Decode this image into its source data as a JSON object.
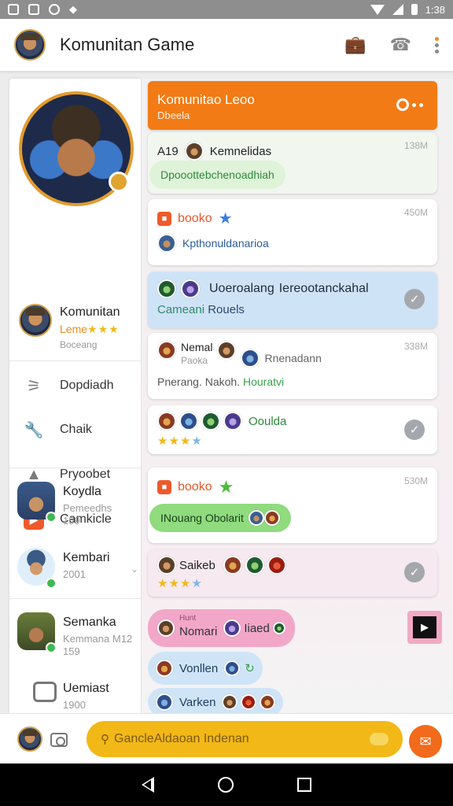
{
  "status_bar": {
    "time": "1:38"
  },
  "app_bar": {
    "title": "Komunitan Game"
  },
  "sidebar": {
    "me": {
      "name": "Komunitan",
      "level": "Leme",
      "stars": "★★★",
      "sub": "Boceang"
    },
    "menu": [
      {
        "label": "Dopdiadh",
        "icon": "puzzle-icon"
      },
      {
        "label": "Chaik",
        "icon": "wrench-icon"
      },
      {
        "label": "Pryoobet",
        "icon": "bag-icon"
      },
      {
        "label": "Camkicle",
        "icon": "games-icon"
      }
    ],
    "contacts": [
      {
        "name": "Koydla",
        "sub1": "Pemeedhs",
        "sub2": "159"
      },
      {
        "name": "Kembari",
        "sub1": "2001"
      },
      {
        "name": "Semanka",
        "sub1": "Kemmana M12",
        "sub2": "159"
      },
      {
        "name": "Uemiast",
        "sub1": "1900"
      }
    ]
  },
  "chat": {
    "header": {
      "title": "Komunitao Leoo",
      "sub": "Dbeela"
    },
    "messages": [
      {
        "sender": "A19",
        "name": "Kemnelidas",
        "time": "138M",
        "bubble": "Dpooottebchenoadhiah"
      },
      {
        "tag": "booko",
        "time": "450M",
        "text": "Kpthonuldanarioa"
      },
      {
        "text1": "Uoeroalang",
        "text2": "Iereootanckahal",
        "line2a": "Cameani",
        "line2b": "Rouels"
      },
      {
        "name": "Nemal",
        "sub": "Paoka",
        "name2": "Rnenadann",
        "time": "338M",
        "line": "Pnerang. Nakoh.",
        "line_link": "Houratvi"
      },
      {
        "text": "Ooulda",
        "stars": "★★★",
        "star_blue": "★"
      },
      {
        "tag": "booko",
        "time": "530M",
        "bubble": "INouang Obolarit"
      },
      {
        "text": "Saikeb",
        "stars": "★★★",
        "star_blue": "★"
      }
    ],
    "bubbles": [
      {
        "small": "Hunt",
        "text": "Nomari",
        "text2": "Iiaed"
      },
      {
        "text": "Vonllen"
      },
      {
        "text": "Varken"
      }
    ]
  },
  "input": {
    "placeholder": "GancleAldaoan Indenan"
  },
  "colors": {
    "accent": "#f27b16",
    "input": "#f2b817",
    "send": "#f26a1b"
  }
}
